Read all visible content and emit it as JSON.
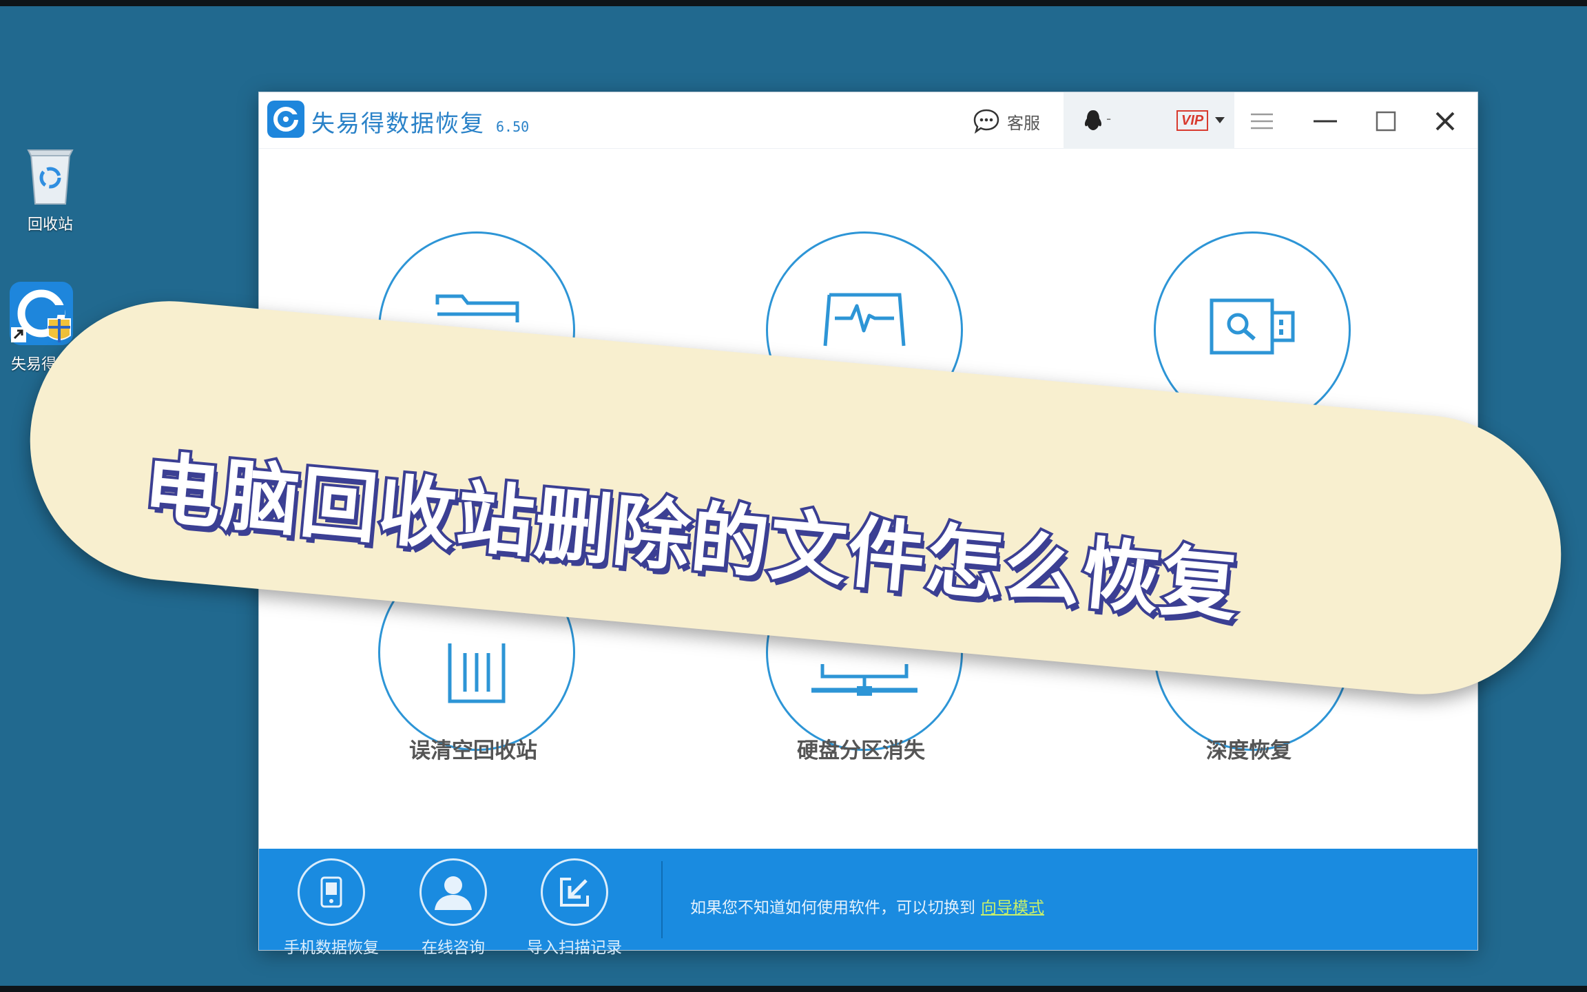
{
  "desktop": {
    "recycle_bin_label": "回收站",
    "app_shortcut_label": "失易得数"
  },
  "window": {
    "title": "失易得数据恢复",
    "version": "6.50",
    "service_label": "客服",
    "user_placeholder": "-",
    "vip_label": "VIP"
  },
  "features": {
    "items": [
      {
        "label": "误清空回收站",
        "icon": "recycle-bin-icon"
      },
      {
        "label": "硬盘分区消失",
        "icon": "disk-partition-icon"
      },
      {
        "label": "深度恢复",
        "icon": "deep-scan-icon"
      }
    ]
  },
  "bottombar": {
    "tools": [
      {
        "label": "手机数据恢复",
        "icon": "phone-icon"
      },
      {
        "label": "在线咨询",
        "icon": "user-icon"
      },
      {
        "label": "导入扫描记录",
        "icon": "import-icon"
      }
    ],
    "hint_text": "如果您不知道如何使用软件，可以切换到",
    "hint_link": "向导模式"
  },
  "overlay": {
    "banner_text": "电脑回收站删除的文件怎么恢复"
  },
  "colors": {
    "desktop_bg": "#21698f",
    "accent_blue": "#2d95d6",
    "bottombar_blue": "#1a8be0",
    "banner_bg": "#f8efcf",
    "banner_text_stroke": "#3b3f93",
    "vip_red": "#d83a2e",
    "hint_link_green": "#c8f06a"
  }
}
